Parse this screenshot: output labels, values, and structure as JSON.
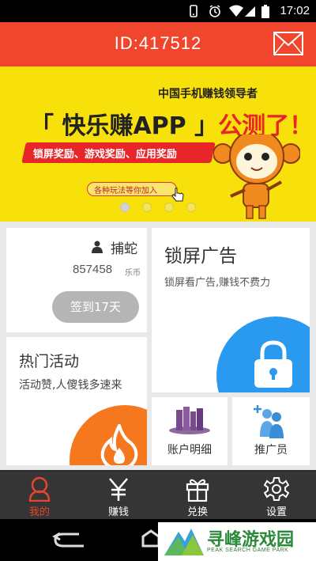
{
  "status_bar": {
    "time": "17:02"
  },
  "header": {
    "title": "ID:417512",
    "mail_icon": "mail-icon"
  },
  "banner": {
    "tagline": "中国手机赚钱领导者",
    "title_open_bracket": "「",
    "title_main": " 快乐赚APP ",
    "title_close_bracket": "」",
    "title_suffix": "公测了！",
    "ribbon_text": "锁屏奖励、游戏奖励、应用奖励",
    "pill_text": "各种玩法等你加入",
    "page_count": 4,
    "active_page": 1
  },
  "user_card": {
    "username": "捕蛇",
    "coins": "857458",
    "coin_unit": "乐币",
    "signin_label": "签到17天"
  },
  "lock_card": {
    "title": "锁屏广告",
    "subtitle": "锁屏看广告,赚钱不费力"
  },
  "hot_card": {
    "title": "热门活动",
    "subtitle": "活动赞,人傻钱多速来"
  },
  "tiles": {
    "account": {
      "label": "账户明细"
    },
    "promoter": {
      "label": "推广员"
    }
  },
  "bottom_nav": [
    {
      "label": "我的",
      "icon": "person-icon",
      "active": true
    },
    {
      "label": "赚钱",
      "icon": "yen-icon",
      "active": false
    },
    {
      "label": "兑换",
      "icon": "gift-icon",
      "active": false
    },
    {
      "label": "设置",
      "icon": "gear-icon",
      "active": false
    }
  ],
  "watermark": {
    "title": "寻峰游戏园",
    "subtitle": "PEAK SEARCH GAME PARK"
  },
  "colors": {
    "header": "#f0462d",
    "banner": "#f8e10a",
    "lock_circle": "#2a9af0",
    "hot_circle": "#f5781e",
    "nav_bg": "#353535",
    "nav_active": "#e8452d"
  }
}
